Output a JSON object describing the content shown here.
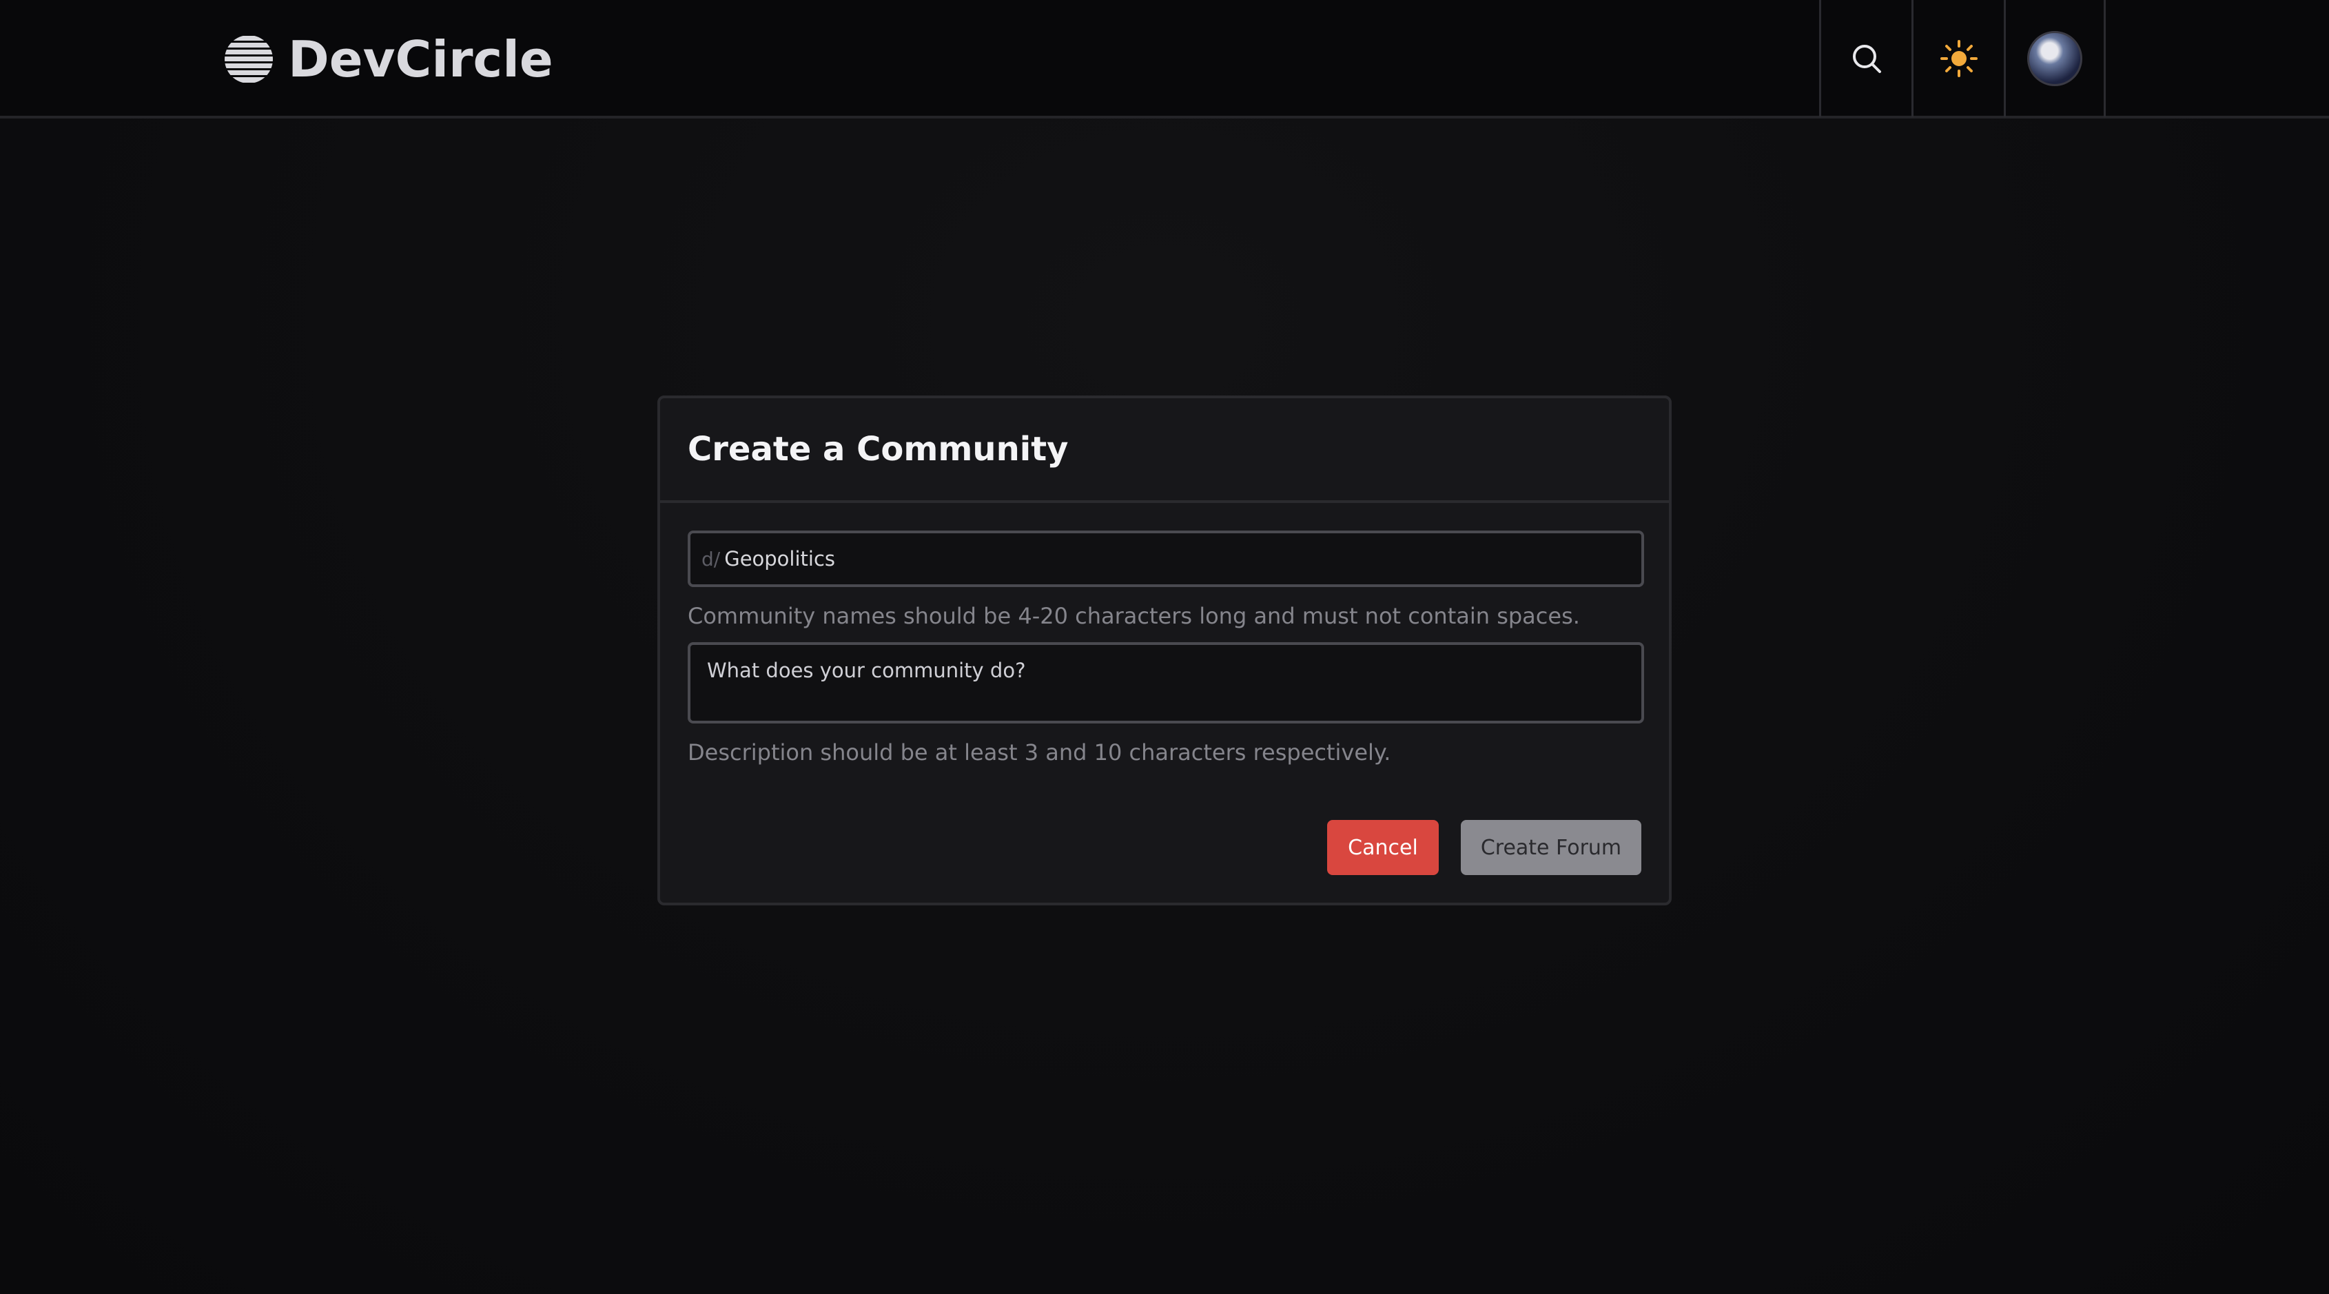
{
  "header": {
    "brand": "DevCircle",
    "icons": {
      "logo": "striped-globe-icon",
      "search": "search-icon",
      "theme": "sun-icon",
      "avatar": "user-avatar"
    },
    "accent_sun": "#f2a93b"
  },
  "modal": {
    "title": "Create a Community",
    "name_prefix": "d/",
    "name_value": "Geopolitics",
    "name_hint": "Community names should be 4-20 characters long and must not contain spaces.",
    "description_placeholder": "What does your community do?",
    "description_hint": "Description should be at least 3 and 10 characters respectively.",
    "cancel_label": "Cancel",
    "create_label": "Create Forum",
    "colors": {
      "cancel": "#d9473f",
      "create": "#8a8a90"
    }
  }
}
